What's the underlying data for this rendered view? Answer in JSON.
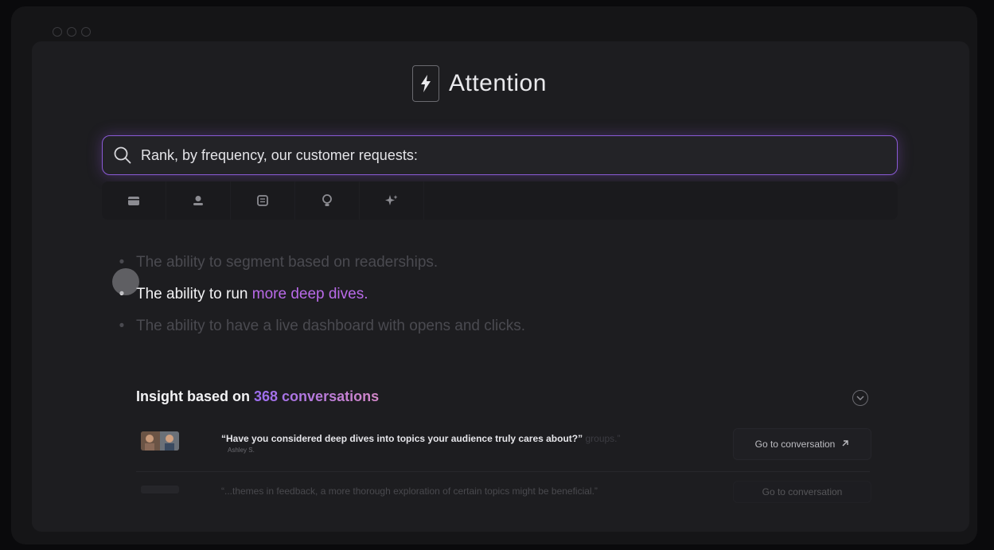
{
  "brand": {
    "name": "Attention",
    "icon": "lightning-bolt-icon"
  },
  "search": {
    "query": "Rank, by frequency, our customer requests:",
    "icon": "search-icon"
  },
  "toolbar": {
    "tools": [
      {
        "name": "calendar-icon"
      },
      {
        "name": "person-icon"
      },
      {
        "name": "document-icon"
      },
      {
        "name": "lightbulb-icon"
      },
      {
        "name": "sparkle-icon"
      }
    ]
  },
  "answers": [
    {
      "text": "The ability to segment based on readerships.",
      "state": "dim"
    },
    {
      "text": "The ability to run ",
      "highlight": "more deep dives.",
      "state": "active"
    },
    {
      "text": "The ability to have a live dashboard with opens and clicks.",
      "state": "dim"
    }
  ],
  "insight": {
    "prefix": "Insight based on ",
    "count": "368 conversations",
    "conversations": [
      {
        "quote": "“Have you considered deep dives into topics your audience truly cares about?”",
        "quote_fade": "groups.”",
        "author": "Ashley S.",
        "action": "Go to conversation"
      },
      {
        "quote": "“...themes in feedback, a more thorough exploration of certain topics might be beneficial.”",
        "action": "Go to conversation"
      }
    ]
  },
  "colors": {
    "accent": "#b96ae8",
    "border": "#8a5ad6",
    "background": "#1d1d20"
  }
}
